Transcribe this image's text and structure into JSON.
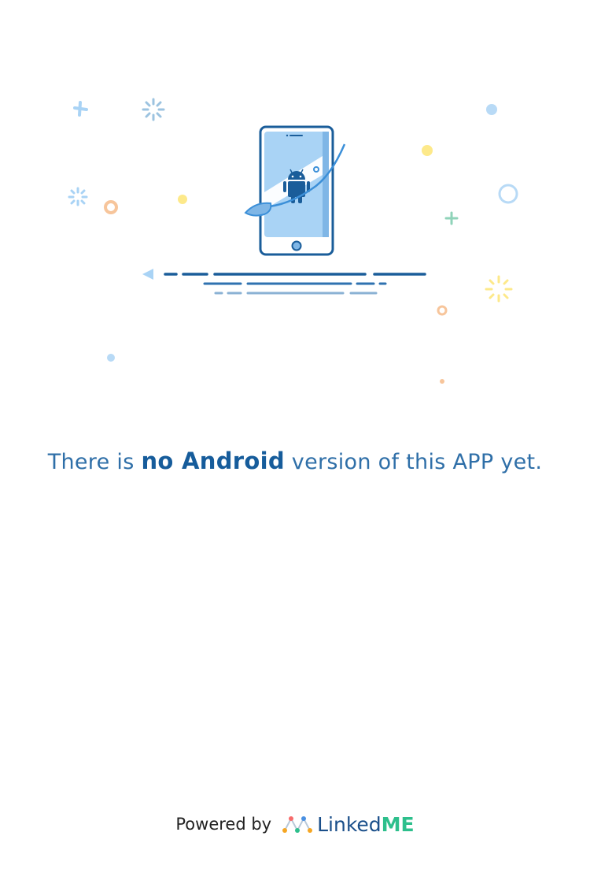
{
  "message": {
    "prefix": "There is ",
    "emphasis": "no Android",
    "suffix": " version of this APP yet."
  },
  "footer": {
    "powered_by": "Powered by",
    "brand_part1": "Linked",
    "brand_part2": "ME"
  },
  "colors": {
    "primary_blue": "#1a5d9a",
    "light_blue": "#a9d3f5",
    "yellow": "#fde98a",
    "orange": "#f7c59b",
    "green": "#7ecbb0",
    "brand_green": "#2dbf8c"
  },
  "icons": {
    "illustration": "phone-with-android-illustration",
    "android": "android-robot-icon",
    "brand_logo": "linkedme-logo-icon"
  }
}
